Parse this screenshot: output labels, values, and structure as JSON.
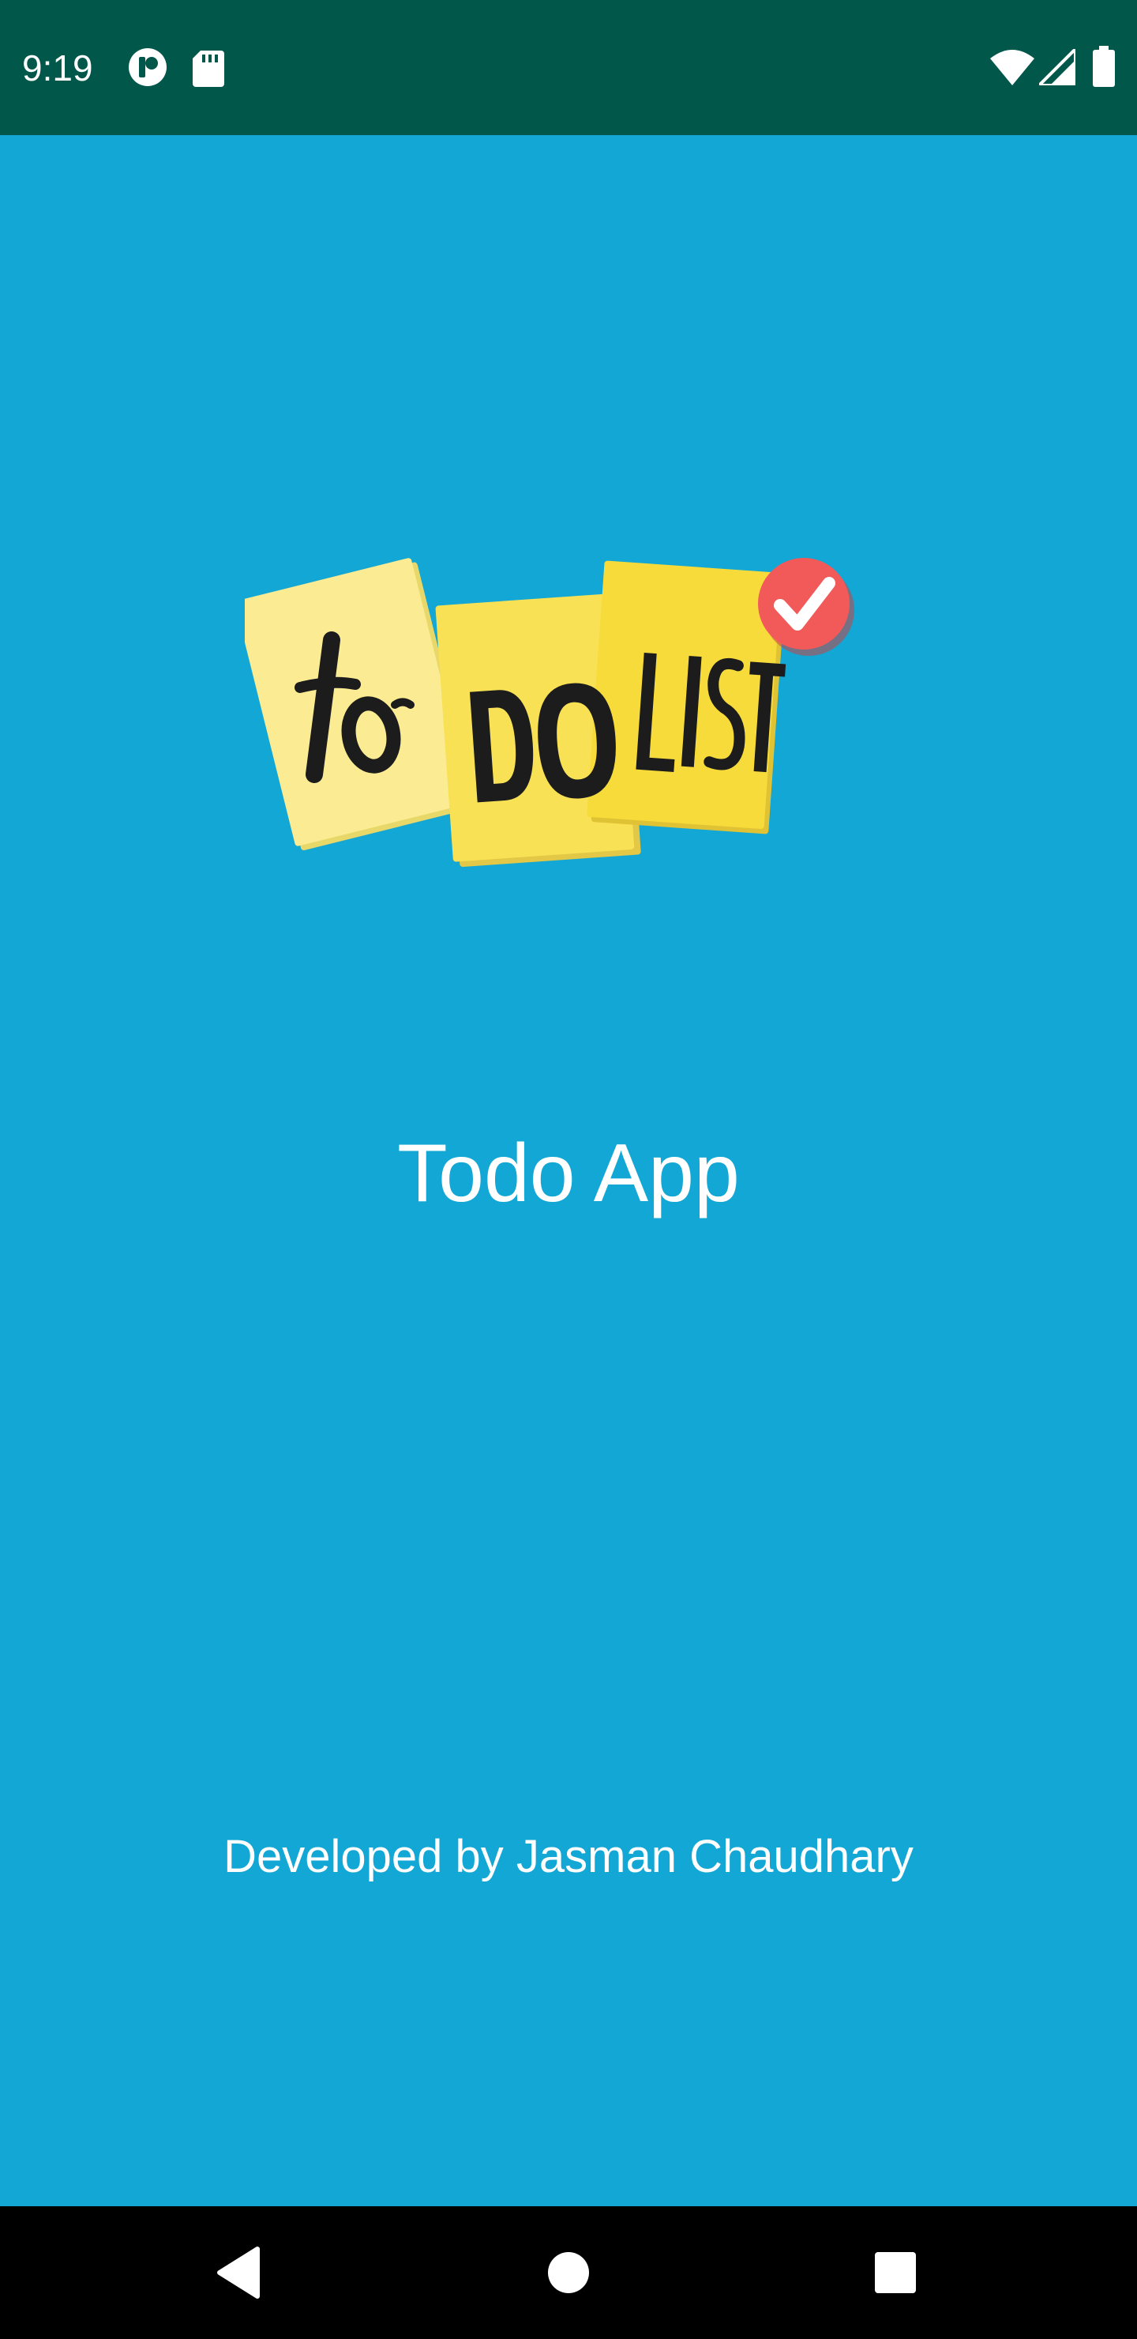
{
  "status_bar": {
    "time": "9:19",
    "icons_left": [
      "app-notification-icon",
      "sd-card-icon"
    ],
    "icons_right": [
      "wifi-icon",
      "cellular-signal-icon",
      "battery-icon"
    ],
    "background": "#01574A"
  },
  "splash": {
    "background": "#12A7D5",
    "logo": {
      "name": "todo-list-logo",
      "words": [
        "to",
        "DO",
        "LIST"
      ],
      "note_colors": [
        "#FBEB92",
        "#F8E155",
        "#F6DB3A"
      ],
      "check_badge_color": "#F25A5A"
    },
    "app_title": "Todo App",
    "developer_credit": "Developed by Jasman Chaudhary"
  },
  "nav_bar": {
    "buttons": [
      "back-icon",
      "home-icon",
      "recents-icon"
    ],
    "background": "#000000"
  }
}
